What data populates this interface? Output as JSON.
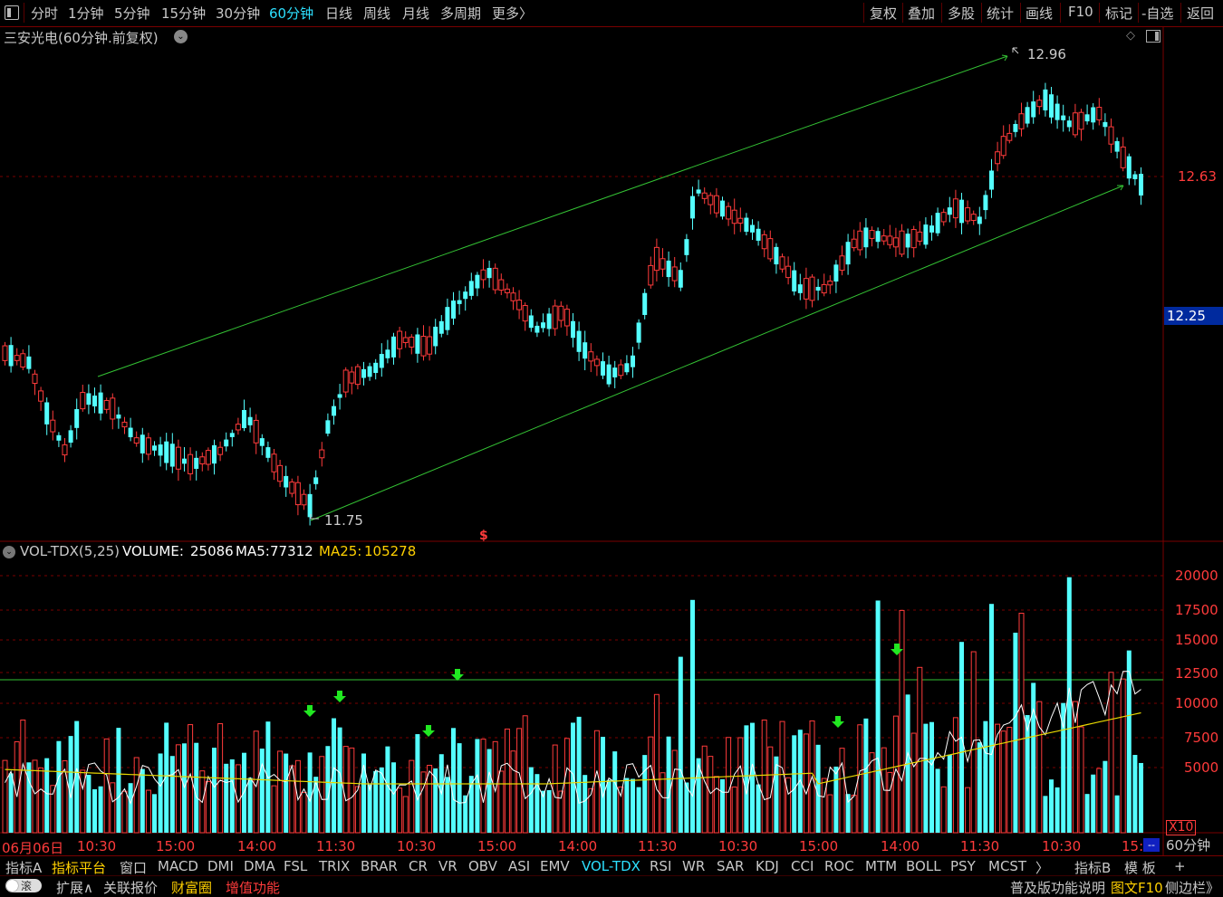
{
  "toolbar": {
    "periods": [
      "分时",
      "1分钟",
      "5分钟",
      "15分钟",
      "30分钟",
      "60分钟",
      "日线",
      "周线",
      "月线",
      "多周期",
      "更多〉"
    ],
    "active_period": "60分钟",
    "right_items": [
      "复权",
      "叠加",
      "多股",
      "统计",
      "画线",
      "F10",
      "标记",
      "-自选",
      "返回"
    ]
  },
  "chart": {
    "title": "三安光电(60分钟.前复权)",
    "high_label": "12.96",
    "low_label": "11.75",
    "price_axis": [
      "12.63",
      "12.25"
    ],
    "marker_s": "$"
  },
  "volume_panel": {
    "name": "VOL-TDX(5,25)",
    "volume_label": "VOLUME:",
    "volume_value": "25086",
    "ma5_label": "MA5:",
    "ma5_value": "77312",
    "ma25_label": "MA25:",
    "ma25_value": "105278",
    "axis": [
      "20000",
      "17500",
      "15000",
      "12500",
      "10000",
      "7500",
      "5000"
    ],
    "unit": "X10"
  },
  "time_axis": [
    "06月06日",
    "10:30",
    "15:00",
    "14:00",
    "11:30",
    "10:30",
    "15:00",
    "14:00",
    "11:30",
    "10:30",
    "15:00",
    "14:00",
    "11:30",
    "10:30",
    "15:"
  ],
  "period_box": "60分钟",
  "indicators": {
    "left": [
      "指标A",
      "指标平台",
      "窗口"
    ],
    "items": [
      "MACD",
      "DMI",
      "DMA",
      "FSL",
      "TRIX",
      "BRAR",
      "CR",
      "VR",
      "OBV",
      "ASI",
      "EMV",
      "VOL-TDX",
      "RSI",
      "WR",
      "SAR",
      "KDJ",
      "CCI",
      "ROC",
      "MTM",
      "BOLL",
      "PSY",
      "MCST"
    ],
    "active": "VOL-TDX",
    "more": "〉",
    "right": [
      "指标B",
      "模 板",
      "+"
    ]
  },
  "status": {
    "toggle": "滚",
    "items": [
      "扩展∧",
      "关联报价",
      "财富圈",
      "增值功能"
    ],
    "right": [
      "普及版功能说明",
      "图文F10",
      "侧边栏》"
    ]
  },
  "colors": {
    "up": "#ff3b3b",
    "down": "#54ffff",
    "accent": "#2de0ff",
    "ma25": "#ffd000",
    "trend": "#34c234"
  }
}
